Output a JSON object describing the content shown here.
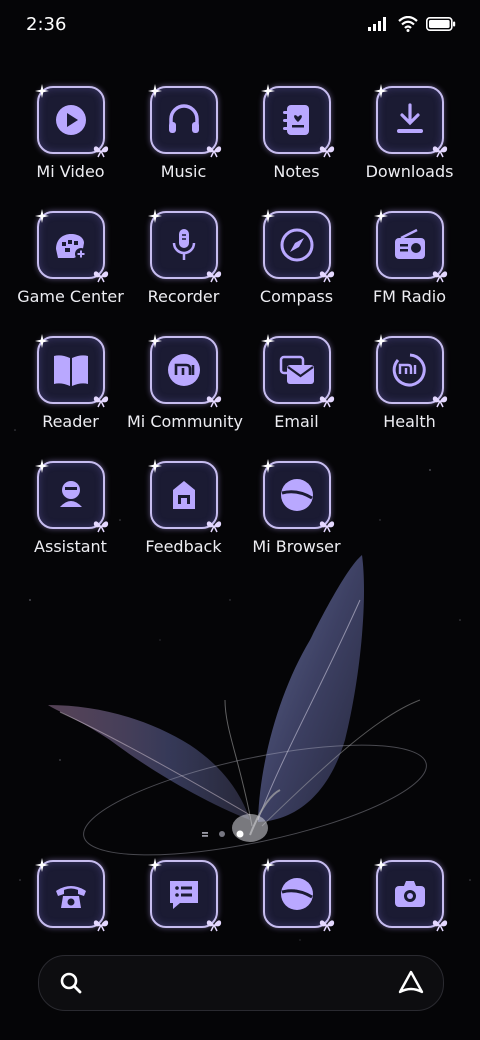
{
  "status": {
    "time": "2:36",
    "battery": "full",
    "wifi": "on",
    "signal": "4-bars"
  },
  "colors": {
    "accent": "#b9a8ff",
    "tile_bg": "#1b1b33",
    "tile_border": "#c7bdf0"
  },
  "apps": [
    {
      "label": "Mi Video",
      "icon": "play-icon"
    },
    {
      "label": "Music",
      "icon": "headphones-icon"
    },
    {
      "label": "Notes",
      "icon": "notes-icon"
    },
    {
      "label": "Downloads",
      "icon": "download-icon"
    },
    {
      "label": "Game Center",
      "icon": "gamepad-icon"
    },
    {
      "label": "Recorder",
      "icon": "microphone-icon"
    },
    {
      "label": "Compass",
      "icon": "compass-icon"
    },
    {
      "label": "FM Radio",
      "icon": "radio-icon"
    },
    {
      "label": "Reader",
      "icon": "book-icon"
    },
    {
      "label": "Mi Community",
      "icon": "mi-logo-icon"
    },
    {
      "label": "Email",
      "icon": "email-icon"
    },
    {
      "label": "Health",
      "icon": "health-icon"
    },
    {
      "label": "Assistant",
      "icon": "assistant-icon"
    },
    {
      "label": "Feedback",
      "icon": "feedback-icon"
    },
    {
      "label": "Mi Browser",
      "icon": "browser-icon"
    }
  ],
  "dock": [
    {
      "icon": "phone-icon"
    },
    {
      "icon": "messages-icon"
    },
    {
      "icon": "browser-icon"
    },
    {
      "icon": "camera-icon"
    }
  ],
  "page_indicator": {
    "pages": 3,
    "current": 3
  },
  "search": {
    "placeholder": ""
  }
}
